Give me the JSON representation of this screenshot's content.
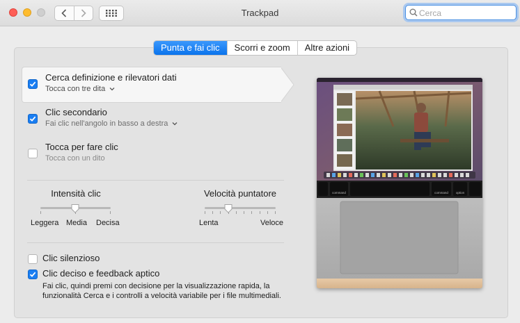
{
  "window": {
    "title": "Trackpad"
  },
  "search": {
    "placeholder": "Cerca"
  },
  "tabs": [
    {
      "label": "Punta e fai clic",
      "active": true
    },
    {
      "label": "Scorri e zoom",
      "active": false
    },
    {
      "label": "Altre azioni",
      "active": false
    }
  ],
  "options": [
    {
      "label": "Cerca definizione e rilevatori dati",
      "sub": "Tocca con tre dita",
      "checked": true,
      "has_menu": true
    },
    {
      "label": "Clic secondario",
      "sub": "Fai clic nell'angolo in basso a destra",
      "checked": true,
      "has_menu": true
    },
    {
      "label": "Tocca per fare clic",
      "sub": "Tocca con un dito",
      "checked": false,
      "has_menu": false
    }
  ],
  "click_intensity": {
    "title": "Intensità clic",
    "labels": [
      "Leggera",
      "Media",
      "Decisa"
    ],
    "value": "Media",
    "position": 0.5
  },
  "pointer_speed": {
    "title": "Velocità puntatore",
    "labels": [
      "Lenta",
      "Veloce"
    ],
    "position": 0.33
  },
  "silent_click": {
    "label": "Clic silenzioso",
    "checked": false
  },
  "force_click": {
    "label": "Clic deciso e feedback aptico",
    "checked": true,
    "description": "Fai clic, quindi premi con decisione per la visualizzazione rapida, la funzionalità Cerca e i controlli a velocità variabile per i file multimediali."
  },
  "preview": {
    "key_left": "command",
    "key_right": "command",
    "key_right2": "option"
  },
  "colors": {
    "accent": "#0a73ec",
    "window_bg": "#ececec",
    "panel_bg": "#e3e3e3"
  }
}
